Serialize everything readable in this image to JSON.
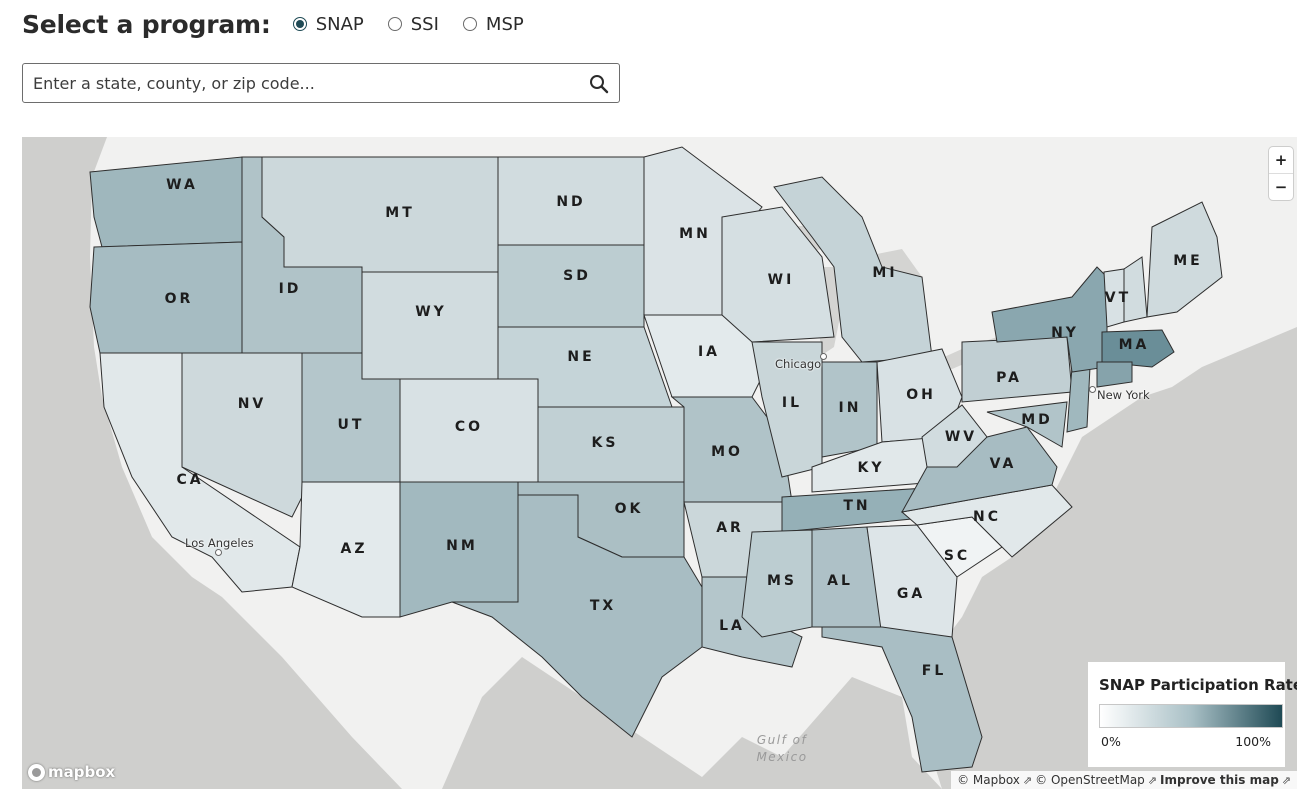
{
  "header": {
    "title": "Select a program:",
    "programs": [
      {
        "label": "SNAP",
        "selected": true
      },
      {
        "label": "SSI",
        "selected": false
      },
      {
        "label": "MSP",
        "selected": false
      }
    ]
  },
  "search": {
    "placeholder": "Enter a state, county, or zip code...",
    "value": ""
  },
  "map": {
    "zoom_in": "+",
    "zoom_out": "−",
    "states": [
      "WA",
      "OR",
      "CA",
      "ID",
      "NV",
      "MT",
      "WY",
      "UT",
      "AZ",
      "CO",
      "NM",
      "ND",
      "SD",
      "NE",
      "KS",
      "OK",
      "TX",
      "MN",
      "IA",
      "MO",
      "AR",
      "LA",
      "WI",
      "IL",
      "MI",
      "IN",
      "OH",
      "KY",
      "TN",
      "MS",
      "AL",
      "GA",
      "FL",
      "SC",
      "NC",
      "VA",
      "WV",
      "PA",
      "MD",
      "NY",
      "VT",
      "ME",
      "MA"
    ],
    "cities": [
      "Chicago",
      "New York",
      "Los Angeles"
    ],
    "water_label": "Gulf of Mexico",
    "logo": "mapbox",
    "attribution": {
      "mapbox": "© Mapbox",
      "osm": "© OpenStreetMap",
      "improve": "Improve this map"
    }
  },
  "legend": {
    "title": "SNAP Participation Rate",
    "min_label": "0%",
    "max_label": "100%",
    "color_low": "#ffffff",
    "color_high": "#1f4a55"
  }
}
